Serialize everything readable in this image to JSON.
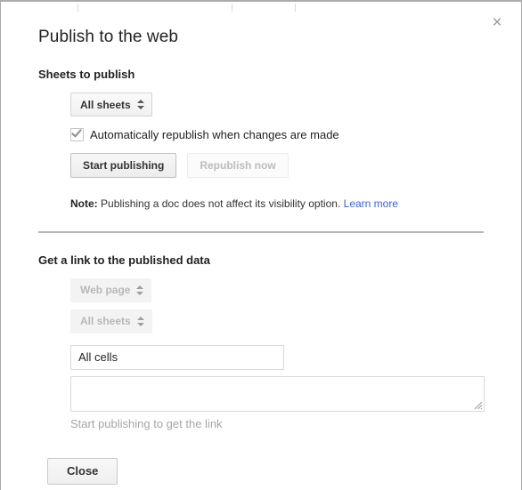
{
  "dialog": {
    "title": "Publish to the web",
    "close_icon": "close-icon",
    "close_glyph": "×"
  },
  "publish_section": {
    "heading": "Sheets to publish",
    "sheets_select": {
      "value": "All sheets",
      "arrow_icon": "chevron-up-down-icon"
    },
    "auto_republish": {
      "label": "Automatically republish when changes are made",
      "checked": true,
      "check_icon": "checkmark-icon"
    },
    "start_publishing_label": "Start publishing",
    "republish_now_label": "Republish now",
    "republish_now_disabled": true,
    "note_prefix": "Note:",
    "note_text": "Publishing a doc does not affect its visibility option.",
    "note_link": "Learn more",
    "link_color": "#3b62d0"
  },
  "link_section": {
    "heading": "Get a link to the published data",
    "format_select": {
      "value": "Web page",
      "disabled": true,
      "arrow_icon": "chevron-up-down-icon"
    },
    "scope_select": {
      "value": "All sheets",
      "disabled": true,
      "arrow_icon": "chevron-up-down-icon"
    },
    "range_input": {
      "value": "All cells",
      "placeholder": "All cells"
    },
    "link_output": {
      "value": "",
      "placeholder": ""
    },
    "resize_icon": "resize-grip-icon",
    "hint": "Start publishing to get the link"
  },
  "footer": {
    "close_label": "Close"
  }
}
